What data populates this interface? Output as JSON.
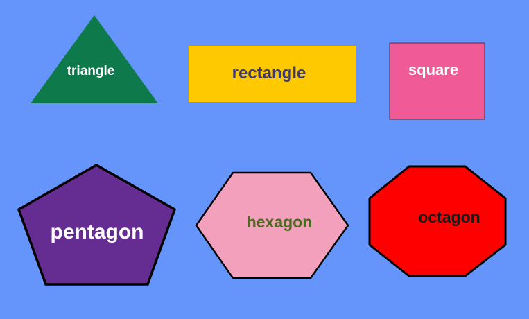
{
  "background_color": "#6595fb",
  "shapes": {
    "triangle": {
      "label": "triangle",
      "fill": "#0e7a4b",
      "text_color": "#ffffff"
    },
    "rectangle": {
      "label": "rectangle",
      "fill": "#ffc900",
      "text_color": "#3e3a6e"
    },
    "square": {
      "label": "square",
      "fill": "#ef5a97",
      "text_color": "#ffffff"
    },
    "pentagon": {
      "label": "pentagon",
      "fill": "#652c91",
      "text_color": "#ffffff"
    },
    "hexagon": {
      "label": "hexagon",
      "fill": "#f3a0bd",
      "text_color": "#4a6a1c"
    },
    "octagon": {
      "label": "octagon",
      "fill": "#fe0000",
      "text_color": "#1a1a1a"
    }
  }
}
